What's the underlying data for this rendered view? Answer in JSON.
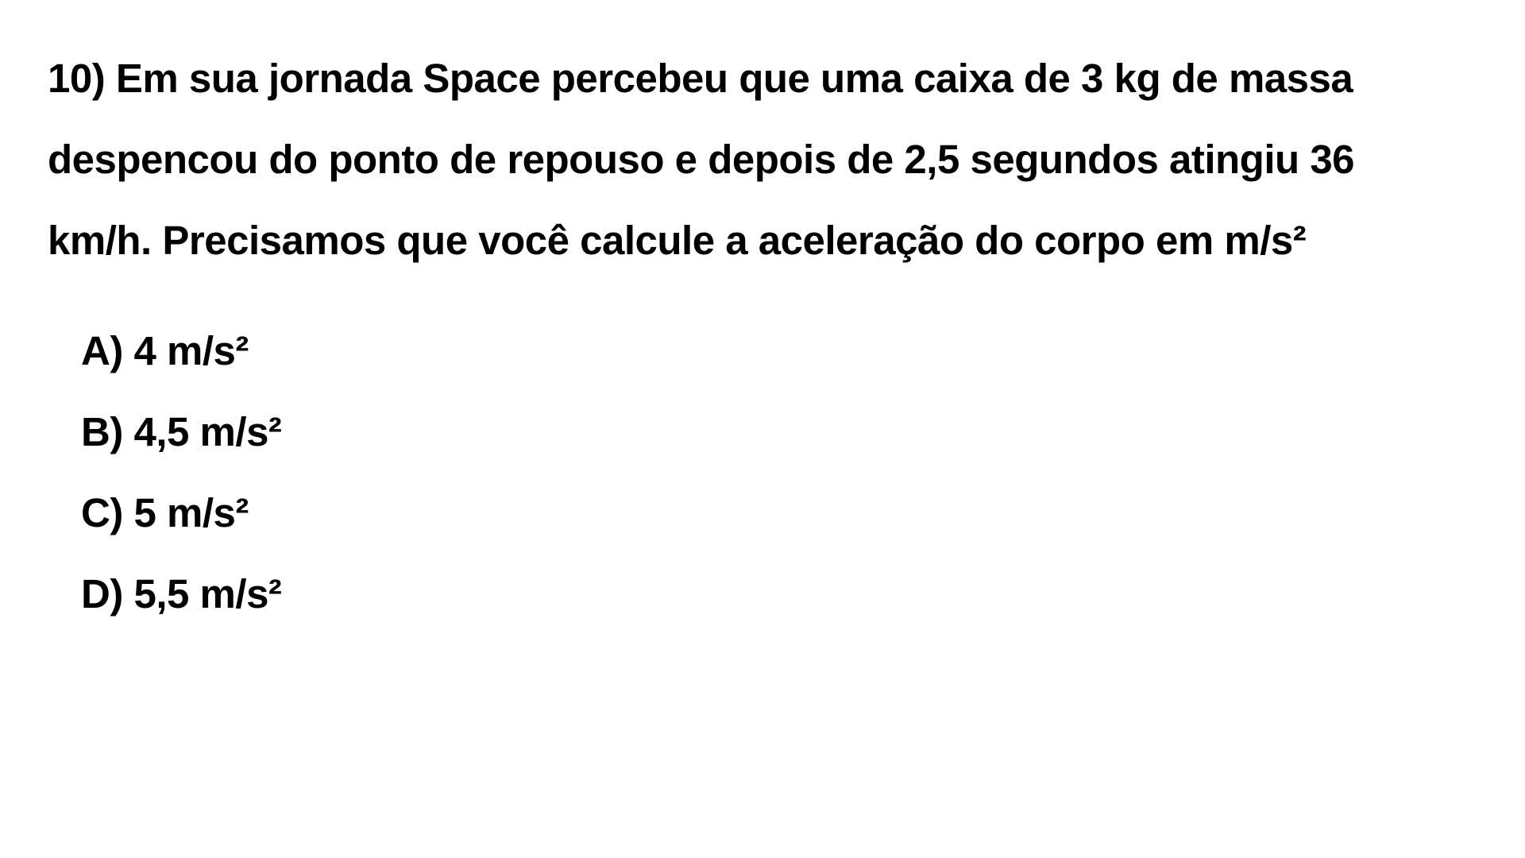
{
  "question": {
    "lines": [
      "10) Em sua jornada Space percebeu que uma caixa de 3 kg de massa",
      "despencou do ponto de repouso e depois de 2,5 segundos atingiu 36",
      "km/h. Precisamos que você calcule a aceleração do corpo em m/s²"
    ]
  },
  "options": [
    "A) 4 m/s²",
    "B) 4,5 m/s²",
    "C) 5 m/s²",
    "D) 5,5 m/s²"
  ]
}
